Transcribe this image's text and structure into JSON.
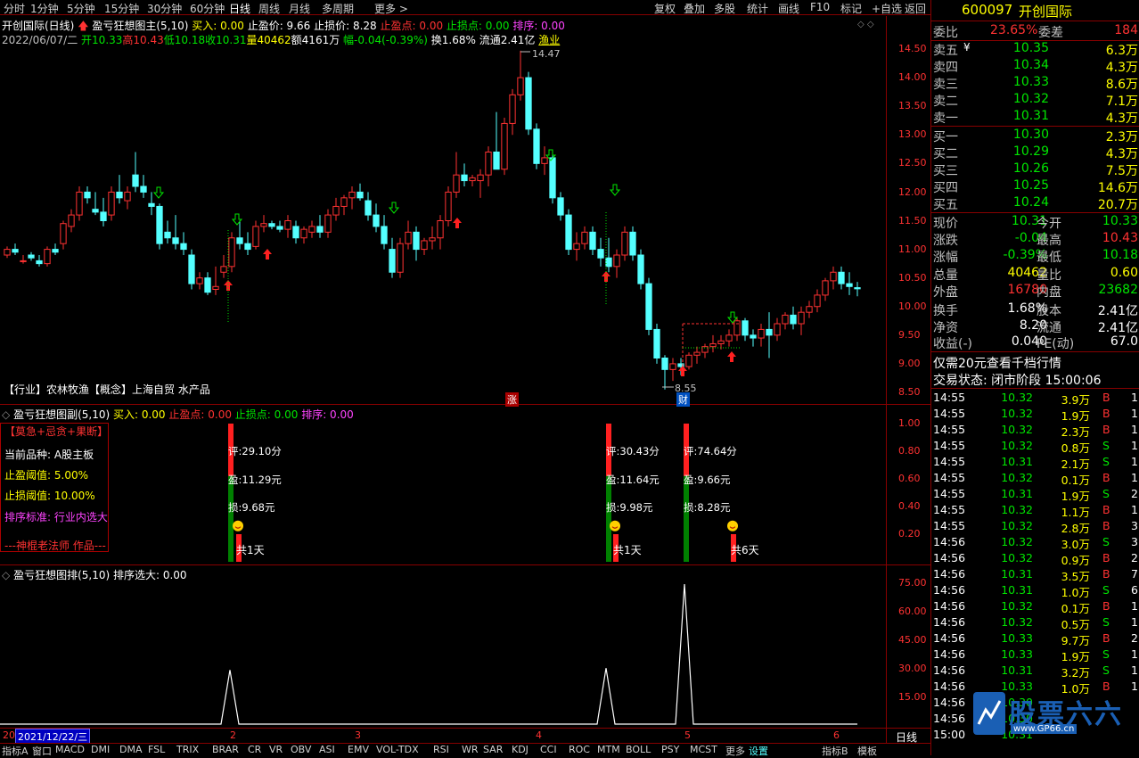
{
  "toolbar": {
    "items": [
      "分时",
      "1分钟",
      "5分钟",
      "15分钟",
      "30分钟",
      "60分钟",
      "日线",
      "周线",
      "月线",
      "多周期",
      "更多 >"
    ],
    "right": [
      "复权",
      "叠加",
      "多股",
      "统计",
      "画线",
      "F10",
      "标记",
      "+自选",
      "返回"
    ]
  },
  "header": {
    "title": "开创国际(日线)",
    "indicator": "盈亏狂想图主(5,10)",
    "buy": "买入: 0.00",
    "stop_profit": "止盈价: 9.66",
    "stop_loss": "止损价: 8.28",
    "tp_point": "止盈点: 0.00",
    "sl_point": "止损点: 0.00",
    "rank": "排序: 0.00"
  },
  "quote_line": {
    "date": "2022/06/07/二",
    "open": "开10.33",
    "high": "高10.43",
    "low": "低10.18",
    "close": "收10.31",
    "vol": "量40462",
    "amount": "额4161万",
    "change": "幅-0.04(-0.39%)",
    "turnover": "换1.68%",
    "float": "流通2.41亿",
    "sector": "渔业"
  },
  "main_chart": {
    "price_ticks": [
      "14.50",
      "14.00",
      "13.50",
      "13.00",
      "12.50",
      "12.00",
      "11.50",
      "11.00",
      "10.50",
      "10.00",
      "9.50",
      "9.00",
      "8.50"
    ],
    "high_label": "14.47",
    "low_label": "8.55",
    "industry": "【行业】农林牧渔【概念】上海自贸 水产品",
    "marker_zhang": "涨",
    "marker_cai": "财"
  },
  "panel2": {
    "title": "盈亏狂想图副(5,10)",
    "buy": "买入: 0.00",
    "tp": "止盈点: 0.00",
    "sl": "止损点: 0.00",
    "rank": "排序: 0.00",
    "tags": "【莫急+忌贪+果断】",
    "variety": "当前品种:",
    "variety_val": "A股主板",
    "tp_thresh": "止盈阈值:",
    "tp_val": "5.00%",
    "sl_thresh": "止损阈值:",
    "sl_val": "10.00%",
    "sort": "排序标准:",
    "sort_val": "行业内选大",
    "author": "---神棍老法师 作品---",
    "ticks": [
      "1.00",
      "0.80",
      "0.60",
      "0.40",
      "0.20"
    ],
    "signals": [
      {
        "score": "",
        "profit": "",
        "loss": "",
        "days": "共1天"
      },
      {
        "score": "评:30.43分",
        "profit": "盈:11.64元",
        "loss": "损:9.98元",
        "days": "共1天"
      },
      {
        "score": "评:74.64分",
        "profit": "盈:9.66元",
        "loss": "损:8.28元",
        "days": "共6天"
      }
    ],
    "sig0": {
      "score": "评:29.10分",
      "profit": "盈:11.29元",
      "loss": "损:9.68元"
    }
  },
  "panel3": {
    "title": "盈亏狂想图排(5,10)",
    "value": "排序选大: 0.00",
    "ticks": [
      "75.00",
      "60.00",
      "45.00",
      "30.00",
      "15.00"
    ]
  },
  "time_axis": {
    "date_box": "2021/12/22/三",
    "prefix": "20",
    "months": [
      "2",
      "3",
      "4",
      "5",
      "6"
    ],
    "right": "日线"
  },
  "bottom_tabs": [
    "指标A",
    "窗口",
    "MACD",
    "DMI",
    "DMA",
    "FSL",
    "TRIX",
    "BRAR",
    "CR",
    "VR",
    "OBV",
    "ASI",
    "EMV",
    "VOL-TDX",
    "RSI",
    "WR",
    "SAR",
    "KDJ",
    "CCI",
    "ROC",
    "MTM",
    "BOLL",
    "PSY",
    "MCST",
    "更多",
    "设置"
  ],
  "bottom_right": [
    "指标B",
    "模板"
  ],
  "side": {
    "code": "600097",
    "name": "开创国际",
    "ratio_l": "委比",
    "ratio_v": "23.65%",
    "diff_l": "委差",
    "diff_v": "184",
    "asks": [
      {
        "l": "卖五",
        "p": "10.35",
        "v": "6.3万",
        "y": "¥"
      },
      {
        "l": "卖四",
        "p": "10.34",
        "v": "4.3万"
      },
      {
        "l": "卖三",
        "p": "10.33",
        "v": "8.6万"
      },
      {
        "l": "卖二",
        "p": "10.32",
        "v": "7.1万"
      },
      {
        "l": "卖一",
        "p": "10.31",
        "v": "4.3万"
      }
    ],
    "bids": [
      {
        "l": "买一",
        "p": "10.30",
        "v": "2.3万"
      },
      {
        "l": "买二",
        "p": "10.29",
        "v": "4.3万"
      },
      {
        "l": "买三",
        "p": "10.26",
        "v": "7.5万"
      },
      {
        "l": "买四",
        "p": "10.25",
        "v": "14.6万"
      },
      {
        "l": "买五",
        "p": "10.24",
        "v": "20.7万"
      }
    ],
    "stats": [
      {
        "l1": "现价",
        "v1": "10.31",
        "l2": "今开",
        "v2": "10.33",
        "c1": "green",
        "c2": "green"
      },
      {
        "l1": "涨跌",
        "v1": "-0.04",
        "l2": "最高",
        "v2": "10.43",
        "c1": "green",
        "c2": "red"
      },
      {
        "l1": "涨幅",
        "v1": "-0.39%",
        "l2": "最低",
        "v2": "10.18",
        "c1": "green",
        "c2": "green"
      },
      {
        "l1": "总量",
        "v1": "40462",
        "l2": "量比",
        "v2": "0.60",
        "c1": "yellow",
        "c2": "yellow"
      },
      {
        "l1": "外盘",
        "v1": "16780",
        "l2": "内盘",
        "v2": "23682",
        "c1": "red",
        "c2": "green"
      },
      {
        "l1": "换手",
        "v1": "1.68%",
        "l2": "股本",
        "v2": "2.41亿",
        "c1": "white",
        "c2": "white"
      },
      {
        "l1": "净资",
        "v1": "8.20",
        "l2": "流通",
        "v2": "2.41亿",
        "c1": "white",
        "c2": "white"
      },
      {
        "l1": "收益(-)",
        "v1": "0.040",
        "l2": "PE(动)",
        "v2": "67.0",
        "c1": "white",
        "c2": "white"
      }
    ],
    "promo": "仅需20元查看千档行情",
    "status": "交易状态: 闭市阶段 15:00:06",
    "ticks": [
      {
        "t": "14:55",
        "p": "10.32",
        "v": "3.9万",
        "s": "B",
        "n": "1"
      },
      {
        "t": "14:55",
        "p": "10.32",
        "v": "1.9万",
        "s": "B",
        "n": "1"
      },
      {
        "t": "14:55",
        "p": "10.32",
        "v": "2.3万",
        "s": "B",
        "n": "1"
      },
      {
        "t": "14:55",
        "p": "10.32",
        "v": "0.8万",
        "s": "S",
        "n": "1"
      },
      {
        "t": "14:55",
        "p": "10.31",
        "v": "2.1万",
        "s": "S",
        "n": "1"
      },
      {
        "t": "14:55",
        "p": "10.32",
        "v": "0.1万",
        "s": "B",
        "n": "1"
      },
      {
        "t": "14:55",
        "p": "10.31",
        "v": "1.9万",
        "s": "S",
        "n": "2"
      },
      {
        "t": "14:55",
        "p": "10.32",
        "v": "1.1万",
        "s": "B",
        "n": "1"
      },
      {
        "t": "14:55",
        "p": "10.32",
        "v": "2.8万",
        "s": "B",
        "n": "3"
      },
      {
        "t": "14:56",
        "p": "10.32",
        "v": "3.0万",
        "s": "S",
        "n": "3"
      },
      {
        "t": "14:56",
        "p": "10.32",
        "v": "0.9万",
        "s": "B",
        "n": "2"
      },
      {
        "t": "14:56",
        "p": "10.31",
        "v": "3.5万",
        "s": "B",
        "n": "7"
      },
      {
        "t": "14:56",
        "p": "10.31",
        "v": "1.0万",
        "s": "S",
        "n": "6"
      },
      {
        "t": "14:56",
        "p": "10.32",
        "v": "0.1万",
        "s": "B",
        "n": "1"
      },
      {
        "t": "14:56",
        "p": "10.32",
        "v": "0.5万",
        "s": "S",
        "n": "1"
      },
      {
        "t": "14:56",
        "p": "10.33",
        "v": "9.7万",
        "s": "B",
        "n": "2"
      },
      {
        "t": "14:56",
        "p": "10.33",
        "v": "1.9万",
        "s": "S",
        "n": "1"
      },
      {
        "t": "14:56",
        "p": "10.31",
        "v": "3.2万",
        "s": "S",
        "n": "1"
      },
      {
        "t": "14:56",
        "p": "10.33",
        "v": "1.0万",
        "s": "B",
        "n": "1"
      },
      {
        "t": "14:56",
        "p": "10.30",
        "v": "",
        "s": "",
        "n": ""
      },
      {
        "t": "14:56",
        "p": "10.30",
        "v": "",
        "s": "",
        "n": ""
      },
      {
        "t": "15:00",
        "p": "10.31",
        "v": "",
        "s": "",
        "n": ""
      }
    ]
  },
  "watermark": {
    "brand": "股票六六",
    "site": "www.GP66.cn"
  }
}
